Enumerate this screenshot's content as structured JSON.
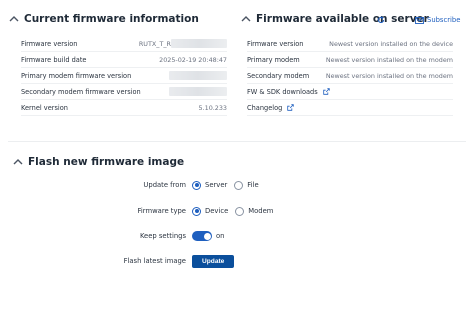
{
  "current_fw": {
    "title": "Current firmware information",
    "rows": [
      {
        "label": "Firmware version",
        "value": "RUTX_T_R"
      },
      {
        "label": "Firmware build date",
        "value": "2025-02-19 20:48:47"
      },
      {
        "label": "Primary modem firmware version",
        "value": ""
      },
      {
        "label": "Secondary modem firmware version",
        "value": ""
      },
      {
        "label": "Kernel version",
        "value": "5.10.233"
      }
    ]
  },
  "available_fw": {
    "title": "Firmware available on server",
    "subscribe_label": "Subscribe",
    "rows": [
      {
        "label": "Firmware version",
        "value": "Newest version installed on the device"
      },
      {
        "label": "Primary modem",
        "value": "Newest version installed on the modem"
      },
      {
        "label": "Secondary modem",
        "value": "Newest version installed on the modem"
      }
    ],
    "links": [
      {
        "label": "FW & SDK downloads"
      },
      {
        "label": "Changelog"
      }
    ]
  },
  "flash": {
    "title": "Flash new firmware image",
    "update_from_label": "Update from",
    "update_from_options": [
      "Server",
      "File"
    ],
    "update_from_selected": "Server",
    "firmware_type_label": "Firmware type",
    "firmware_type_options": [
      "Device",
      "Modem"
    ],
    "firmware_type_selected": "Device",
    "keep_settings_label": "Keep settings",
    "keep_settings_state": "on",
    "flash_latest_label": "Flash latest image",
    "update_button": "Update"
  },
  "colors": {
    "accent": "#1f5fbf",
    "button": "#0b4f9c"
  }
}
